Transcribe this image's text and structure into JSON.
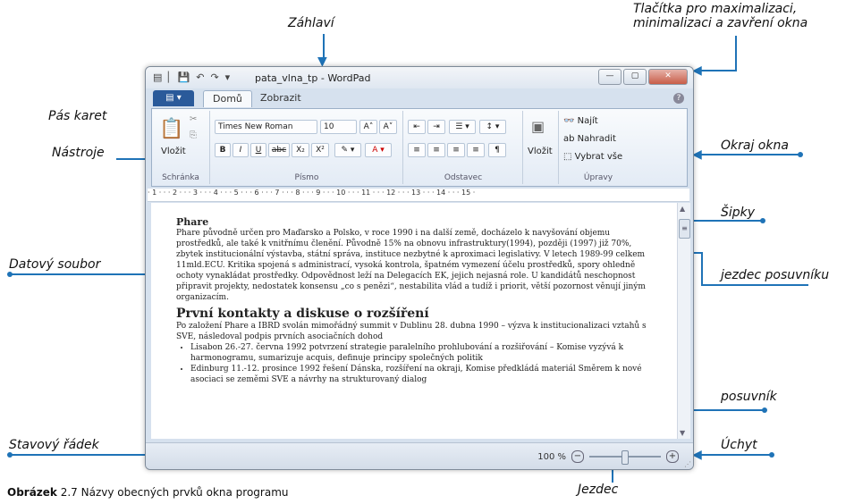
{
  "callouts": {
    "zahlavi": "Záhlaví",
    "tlacitka": "Tlačítka pro maximalizaci,\nminimalizaci a zavření okna",
    "pas_karet": "Pás karet",
    "nastroje": "Nástroje",
    "okraj_okna": "Okraj okna",
    "sipky": "Šipky",
    "datovy_soubor": "Datový soubor",
    "jezdec_posuvniku": "jezdec posuvníku",
    "posuvnik": "posuvník",
    "stavovy_radek": "Stavový řádek",
    "uchyt": "Úchyt",
    "jezdec": "Jezdec"
  },
  "caption": {
    "bold": "Obrázek",
    "text": " 2.7 Názvy obecných prvků okna programu"
  },
  "window": {
    "title": "pata_vlna_tp - WordPad",
    "tabs": [
      "Domů",
      "Zobrazit"
    ],
    "font_name": "Times New Roman",
    "font_size": "10",
    "groups": {
      "schranka": "Schránka",
      "pismo": "Písmo",
      "odstavec": "Odstavec",
      "upravy": "Úpravy"
    },
    "buttons": {
      "vlozit": "Vložit",
      "vlozit2": "Vložit",
      "najit": "Najít",
      "nahradit": "Nahradit",
      "vybrat_vse": "Vybrat vše"
    },
    "ruler": "· 1 · · · 2 · · · 3 · · · 4 · · · 5 · · · 6 · · · 7 · · · 8 · · · 9 · · · 10 · · · 11 · · · 12 · · · 13 · · · 14 · · · 15 ·",
    "zoom": "100 %"
  },
  "document": {
    "h1": "Phare",
    "p1": "Phare původně určen pro Maďarsko a Polsko, v roce 1990 i na další země, docházelo k navyšování objemu prostředků, ale také k vnitřnímu členění. Původně 15% na obnovu infrastruktury(1994), později (1997) již 70%, zbytek institucionální výstavba, státní správa, instituce nezbytné k aproximaci legislativy. V letech 1989-99 celkem 11mld.ECU. Kritika spojená s administrací, vysoká kontrola, špatném vymezení účelu prostředků, spory ohledně ochoty vynakládat prostředky. Odpovědnost leží na Delegacích EK, jejich nejasná role. U kandidátů neschopnost připravit projekty, nedostatek konsensu „co s penězi“, nestabilita vlád a tudíž i priorit, větší pozornost věnují jiným organizacím.",
    "h2": "První kontakty a diskuse o rozšíření",
    "p2": "Po založení Phare a IBRD svolán mimořádný summit v Dublinu 28. dubna 1990 – výzva k institucionalizaci vztahů s SVE, následoval podpis prvních asociačních dohod",
    "li1": "Lisabon 26.-27. června 1992 potvrzení strategie paralelního prohlubování a rozšiřování – Komise vyzývá k harmonogramu, sumarizuje acquis, definuje principy společných politik",
    "li2": "Edinburg 11.-12. prosince 1992 řešení Dánska, rozšíření na okraji, Komise předkládá materiál Směrem k nové asociaci se zeměmi SVE a návrhy na strukturovaný dialog"
  },
  "colors": {
    "accent": "#1f73b7"
  }
}
